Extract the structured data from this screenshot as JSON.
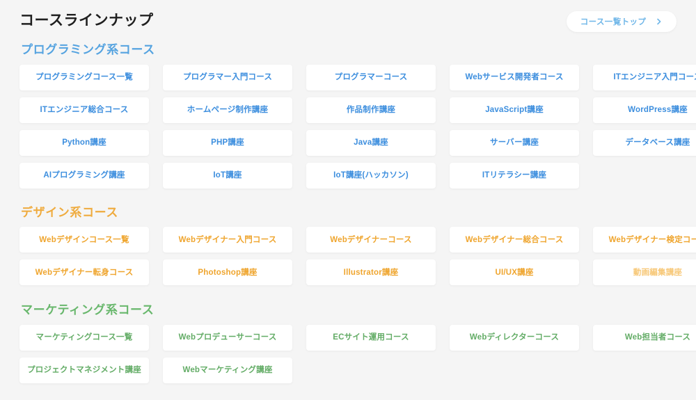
{
  "header": {
    "title": "コースラインナップ",
    "top_link": {
      "label": "コース一覧トップ",
      "icon": "chevron-right-icon"
    }
  },
  "colors": {
    "background": "#f5f5f5",
    "card_background": "#ffffff",
    "title_text": "#1f1f1f",
    "programming_accent": "#55a3e0",
    "programming_card_text": "#3c8ede",
    "design_accent": "#efab3e",
    "design_card_text": "#efa52e",
    "design_card_text_faded": "#f7c878",
    "marketing_accent": "#68b76c",
    "marketing_card_text": "#63ac66",
    "top_link_text": "#6fb6e8"
  },
  "sections": [
    {
      "id": "programming",
      "title": "プログラミング系コース",
      "cards": [
        {
          "label": "プログラミングコース一覧"
        },
        {
          "label": "プログラマー入門コース"
        },
        {
          "label": "プログラマーコース"
        },
        {
          "label": "Webサービス開発者コース"
        },
        {
          "label": "ITエンジニア入門コース"
        },
        {
          "label": "ITエンジニア総合コース"
        },
        {
          "label": "ホームページ制作講座"
        },
        {
          "label": "作品制作講座"
        },
        {
          "label": "JavaScript講座"
        },
        {
          "label": "WordPress講座"
        },
        {
          "label": "Python講座"
        },
        {
          "label": "PHP講座"
        },
        {
          "label": "Java講座"
        },
        {
          "label": "サーバー講座"
        },
        {
          "label": "データベース講座"
        },
        {
          "label": "AIプログラミング講座"
        },
        {
          "label": "IoT講座"
        },
        {
          "label": "IoT講座(ハッカソン)"
        },
        {
          "label": "ITリテラシー講座"
        }
      ]
    },
    {
      "id": "design",
      "title": "デザイン系コース",
      "cards": [
        {
          "label": "Webデザインコース一覧"
        },
        {
          "label": "Webデザイナー入門コース"
        },
        {
          "label": "Webデザイナーコース"
        },
        {
          "label": "Webデザイナー総合コース"
        },
        {
          "label": "Webデザイナー検定コース"
        },
        {
          "label": "Webデザイナー転身コース"
        },
        {
          "label": "Photoshop講座"
        },
        {
          "label": "Illustrator講座"
        },
        {
          "label": "UI/UX講座"
        },
        {
          "label": "動画編集講座",
          "faded": true
        }
      ]
    },
    {
      "id": "marketing",
      "title": "マーケティング系コース",
      "cards": [
        {
          "label": "マーケティングコース一覧"
        },
        {
          "label": "Webプロデューサーコース"
        },
        {
          "label": "ECサイト運用コース"
        },
        {
          "label": "Webディレクターコース"
        },
        {
          "label": "Web担当者コース"
        },
        {
          "label": "プロジェクトマネジメント講座"
        },
        {
          "label": "Webマーケティング講座"
        }
      ]
    }
  ]
}
